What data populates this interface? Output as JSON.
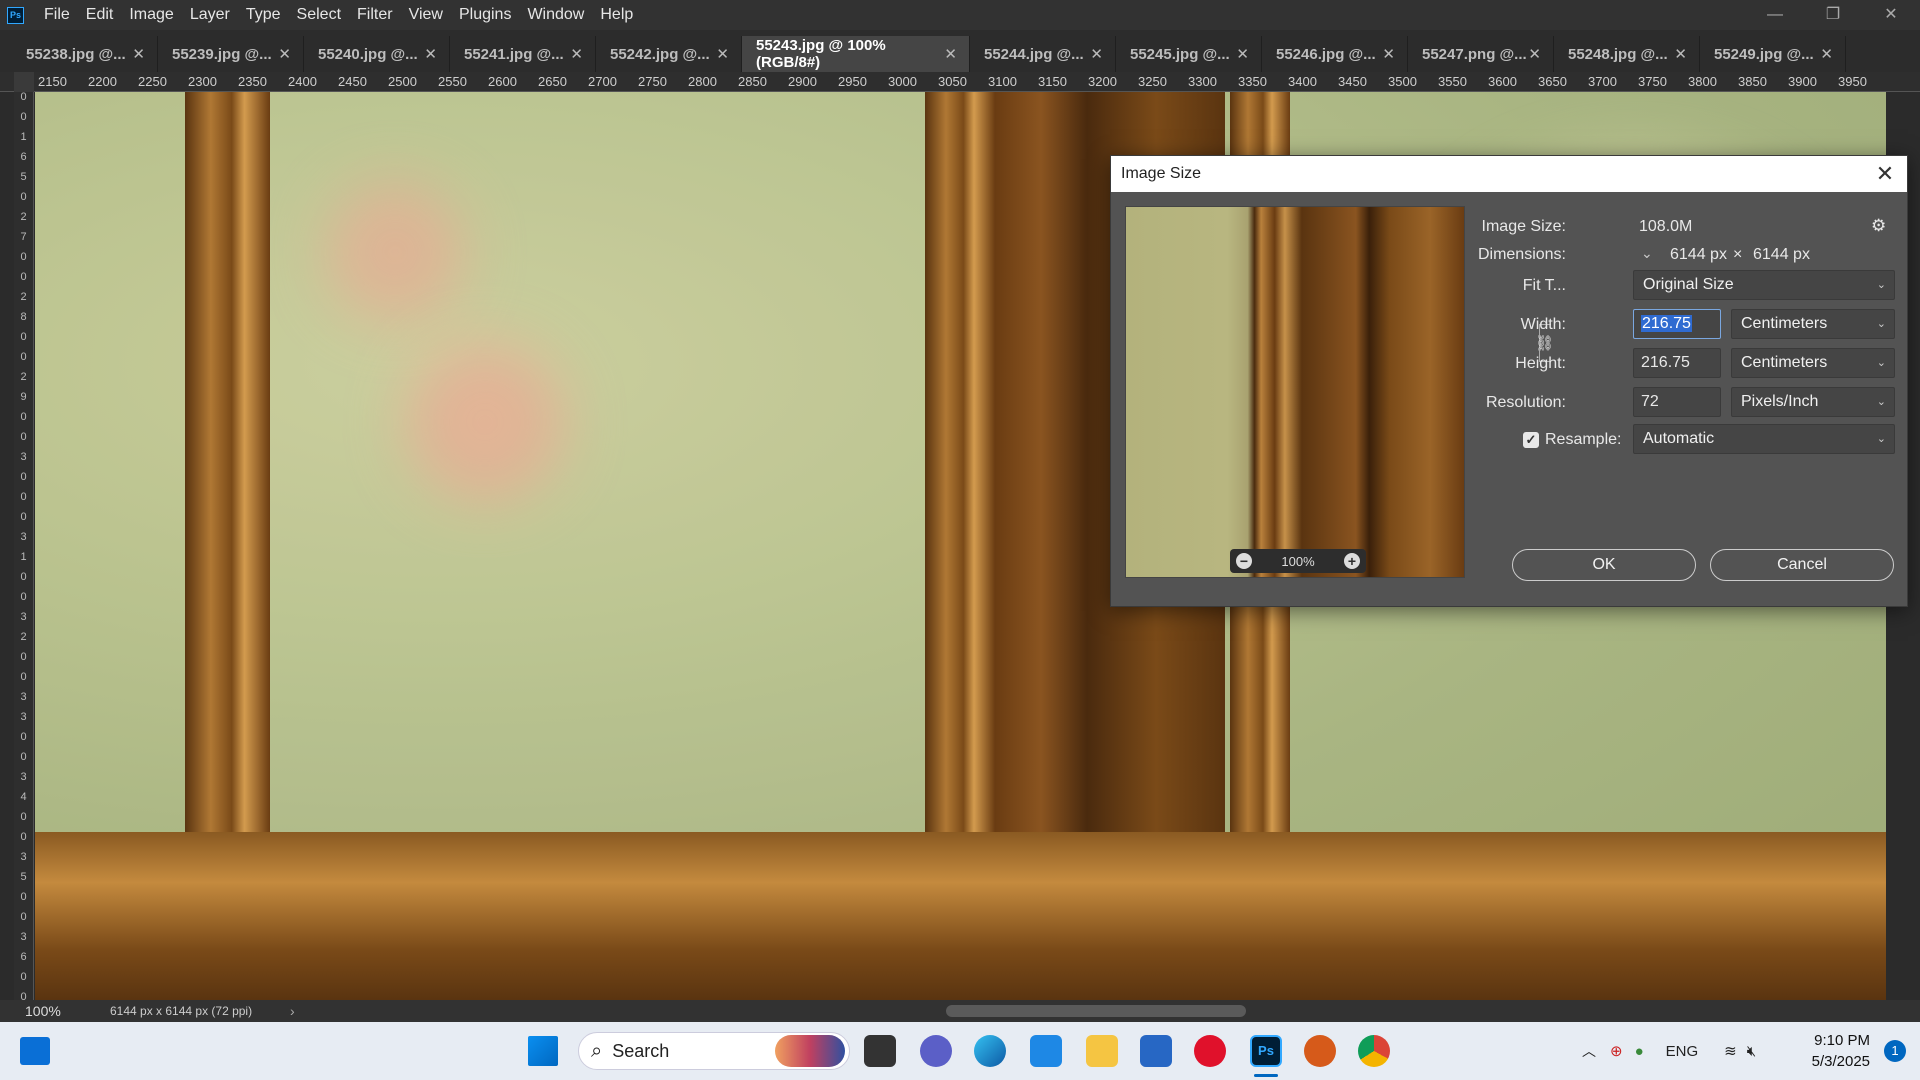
{
  "menubar": {
    "app_icon": "Ps",
    "items": [
      "File",
      "Edit",
      "Image",
      "Layer",
      "Type",
      "Select",
      "Filter",
      "View",
      "Plugins",
      "Window",
      "Help"
    ],
    "window_controls": [
      "—",
      "❐",
      "✕"
    ]
  },
  "tabs": [
    {
      "label": "55238.jpg @..."
    },
    {
      "label": "55239.jpg @..."
    },
    {
      "label": "55240.jpg @..."
    },
    {
      "label": "55241.jpg @..."
    },
    {
      "label": "55242.jpg @..."
    },
    {
      "label": "55243.jpg @ 100% (RGB/8#)"
    },
    {
      "label": "55244.jpg @..."
    },
    {
      "label": "55245.jpg @..."
    },
    {
      "label": "55246.jpg @..."
    },
    {
      "label": "55247.png @..."
    },
    {
      "label": "55248.jpg @..."
    },
    {
      "label": "55249.jpg @..."
    }
  ],
  "ruler": {
    "h_labels": [
      "2150",
      "2200",
      "2250",
      "2300",
      "2350",
      "2400",
      "2450",
      "2500",
      "2550",
      "2600",
      "2650",
      "2700",
      "2750",
      "2800",
      "2850",
      "2900",
      "2950",
      "3000",
      "3050",
      "3100",
      "3150",
      "3200",
      "3250",
      "3300",
      "3350",
      "3400",
      "3450",
      "3500",
      "3550",
      "3600",
      "3650",
      "3700",
      "3750",
      "3800",
      "3850",
      "3900",
      "3950"
    ],
    "v_labels": [
      "0",
      "0",
      "1",
      "6",
      "5",
      "0",
      "2",
      "7",
      "0",
      "0",
      "2",
      "8",
      "0",
      "0",
      "2",
      "9",
      "0",
      "0",
      "3",
      "0",
      "0",
      "0",
      "3",
      "1",
      "0",
      "0",
      "3",
      "2",
      "0",
      "0",
      "3",
      "3",
      "0",
      "0",
      "3",
      "4",
      "0",
      "0",
      "3",
      "5",
      "0",
      "0",
      "3",
      "6",
      "0",
      "0"
    ]
  },
  "status": {
    "zoom": "100%",
    "doc_info": "6144 px x 6144 px (72 ppi)",
    "arrow": "›"
  },
  "dialog": {
    "title": "Image Size",
    "close": "✕",
    "image_size_label": "Image Size:",
    "image_size_value": "108.0M",
    "dimensions_label": "Dimensions:",
    "dim_w": "6144 px",
    "dim_x": "×",
    "dim_h": "6144 px",
    "fit_label": "Fit T...",
    "fit_value": "Original Size",
    "width_label": "Width:",
    "width_value": "216.75",
    "width_unit": "Centimeters",
    "height_label": "Height:",
    "height_value": "216.75",
    "height_unit": "Centimeters",
    "resolution_label": "Resolution:",
    "resolution_value": "72",
    "resolution_unit": "Pixels/Inch",
    "resample_label": "Resample:",
    "resample_value": "Automatic",
    "resample_checked": true,
    "preview_zoom": "100%",
    "ok": "OK",
    "cancel": "Cancel"
  },
  "taskbar": {
    "search_placeholder": "Search",
    "lang": "ENG",
    "time": "9:10 PM",
    "date": "5/3/2025",
    "notification_count": "1"
  }
}
